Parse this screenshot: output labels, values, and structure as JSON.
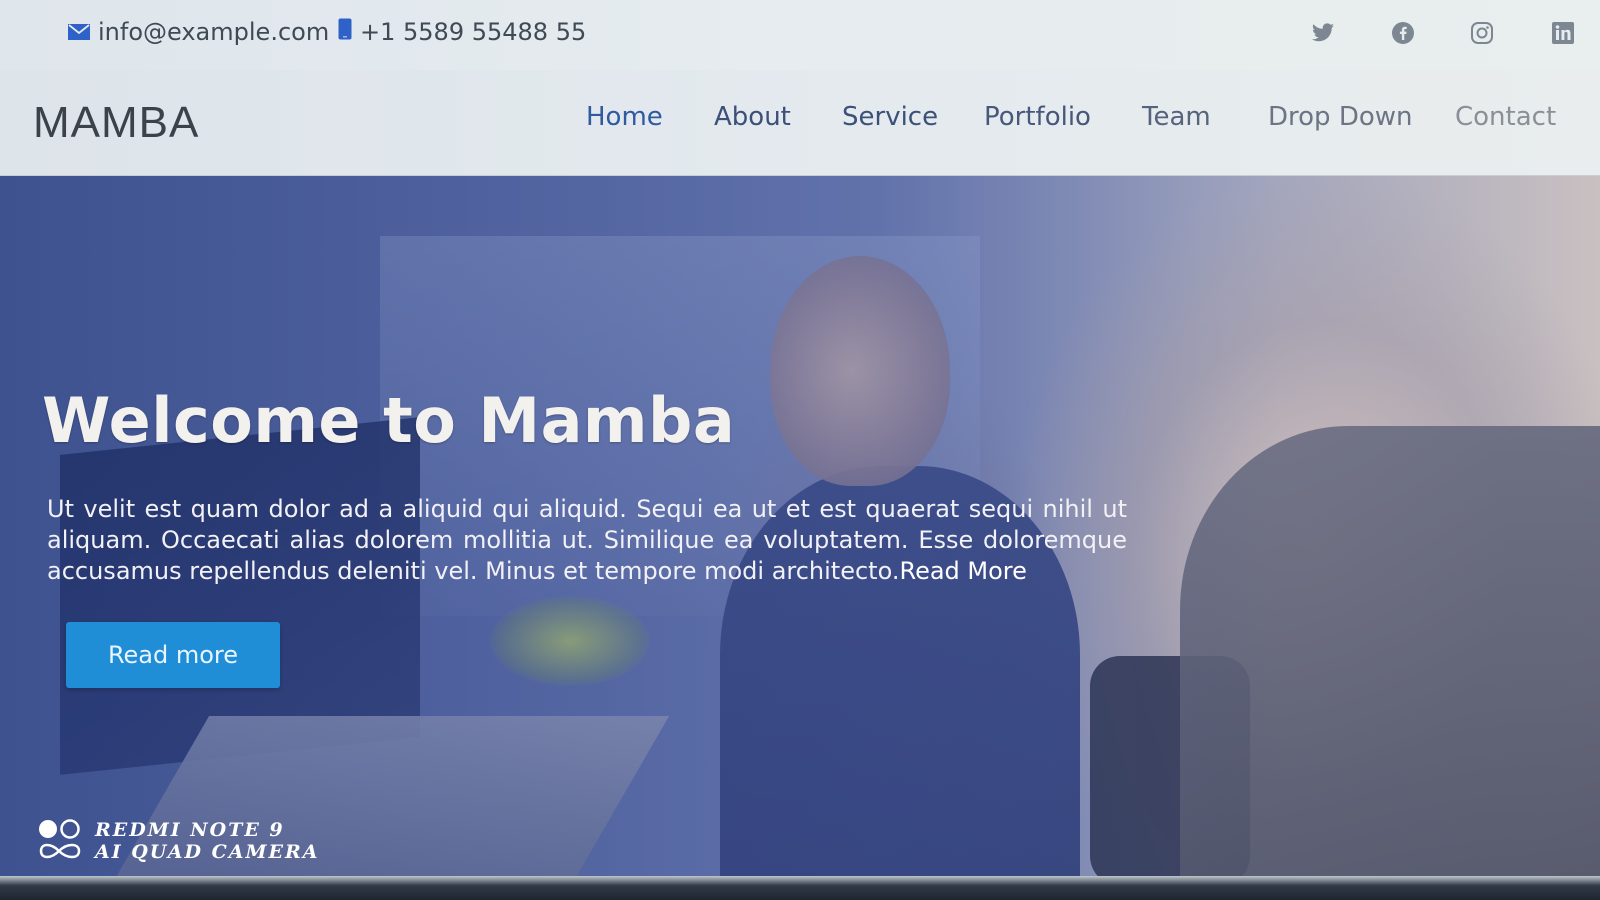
{
  "topbar": {
    "email": "info@example.com",
    "phone": "+1 5589 55488 55",
    "email_icon": "envelope-icon",
    "phone_icon": "phone-icon",
    "social_icons": [
      "twitter-icon",
      "facebook-icon",
      "instagram-icon",
      "linkedin-icon"
    ]
  },
  "header": {
    "logo": "MAMBA",
    "nav": [
      {
        "label": "Home"
      },
      {
        "label": "About"
      },
      {
        "label": "Service"
      },
      {
        "label": "Portfolio"
      },
      {
        "label": "Team"
      },
      {
        "label": "Drop Down"
      },
      {
        "label": "Contact"
      }
    ]
  },
  "hero": {
    "title": "Welcome to Mamba",
    "text": "Ut velit est quam dolor ad a aliquid qui aliquid. Sequi ea ut et est quaerat sequi nihil ut aliquam. Occaecati alias dolorem mollitia ut. Similique ea voluptatem. Esse doloremque accusamus repellendus deleniti vel. Minus et tempore modi architecto.",
    "inline_link": "Read More",
    "button_label": "Read more"
  },
  "watermark": {
    "line1": "REDMI NOTE 9",
    "line2": "AI QUAD CAMERA"
  },
  "colors": {
    "accent": "#1f8ed6",
    "nav_active": "#2f5aa0",
    "hero_overlay": "#4a5e98"
  }
}
